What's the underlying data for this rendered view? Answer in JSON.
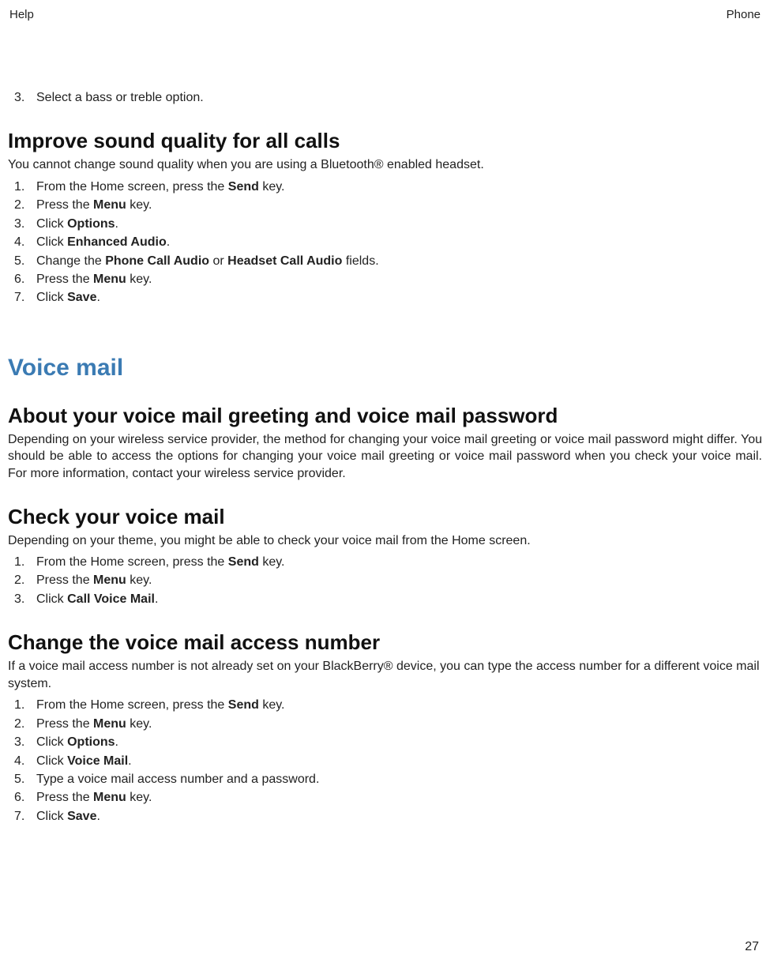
{
  "header": {
    "left": "Help",
    "right": "Phone"
  },
  "page_number": "27",
  "prior_step": {
    "num": "3.",
    "text": "Select a bass or treble option."
  },
  "sound_quality": {
    "heading": "Improve sound quality for all calls",
    "intro": "You cannot change sound quality when you are using a Bluetooth® enabled headset.",
    "steps": [
      {
        "num": "1.",
        "pre": "From the Home screen, press the ",
        "bold": "Send",
        "post": " key."
      },
      {
        "num": "2.",
        "pre": "Press the ",
        "bold": "Menu",
        "post": " key."
      },
      {
        "num": "3.",
        "pre": "Click ",
        "bold": "Options",
        "post": "."
      },
      {
        "num": "4.",
        "pre": "Click ",
        "bold": "Enhanced Audio",
        "post": "."
      },
      {
        "num": "5.",
        "pre": "Change the ",
        "bold": "Phone Call Audio",
        "mid": " or ",
        "bold2": "Headset Call Audio",
        "post": " fields."
      },
      {
        "num": "6.",
        "pre": "Press the ",
        "bold": "Menu",
        "post": " key."
      },
      {
        "num": "7.",
        "pre": "Click ",
        "bold": "Save",
        "post": "."
      }
    ]
  },
  "voice_mail": {
    "heading": "Voice mail",
    "about": {
      "heading": "About your voice mail greeting and voice mail password",
      "para": "Depending on your wireless service provider, the method for changing your voice mail greeting or voice mail password might differ. You should be able to access the options for changing your voice mail greeting or voice mail password when you check your voice mail. For more information, contact your wireless service provider."
    },
    "check": {
      "heading": "Check your voice mail",
      "intro": "Depending on your theme, you might be able to check your voice mail from the Home screen.",
      "steps": [
        {
          "num": "1.",
          "pre": "From the Home screen, press the ",
          "bold": "Send",
          "post": " key."
        },
        {
          "num": "2.",
          "pre": "Press the ",
          "bold": "Menu",
          "post": " key."
        },
        {
          "num": "3.",
          "pre": "Click ",
          "bold": "Call Voice Mail",
          "post": "."
        }
      ]
    },
    "change": {
      "heading": "Change the voice mail access number",
      "intro": "If a voice mail access number is not already set on your BlackBerry® device, you can type the access number for a different voice mail system.",
      "steps": [
        {
          "num": "1.",
          "pre": "From the Home screen, press the ",
          "bold": "Send",
          "post": " key."
        },
        {
          "num": "2.",
          "pre": "Press the ",
          "bold": "Menu",
          "post": " key."
        },
        {
          "num": "3.",
          "pre": "Click ",
          "bold": "Options",
          "post": "."
        },
        {
          "num": "4.",
          "pre": "Click ",
          "bold": "Voice Mail",
          "post": "."
        },
        {
          "num": "5.",
          "pre": "Type a voice mail access number and a password.",
          "bold": "",
          "post": ""
        },
        {
          "num": "6.",
          "pre": "Press the ",
          "bold": "Menu",
          "post": " key."
        },
        {
          "num": "7.",
          "pre": "Click ",
          "bold": "Save",
          "post": "."
        }
      ]
    }
  }
}
